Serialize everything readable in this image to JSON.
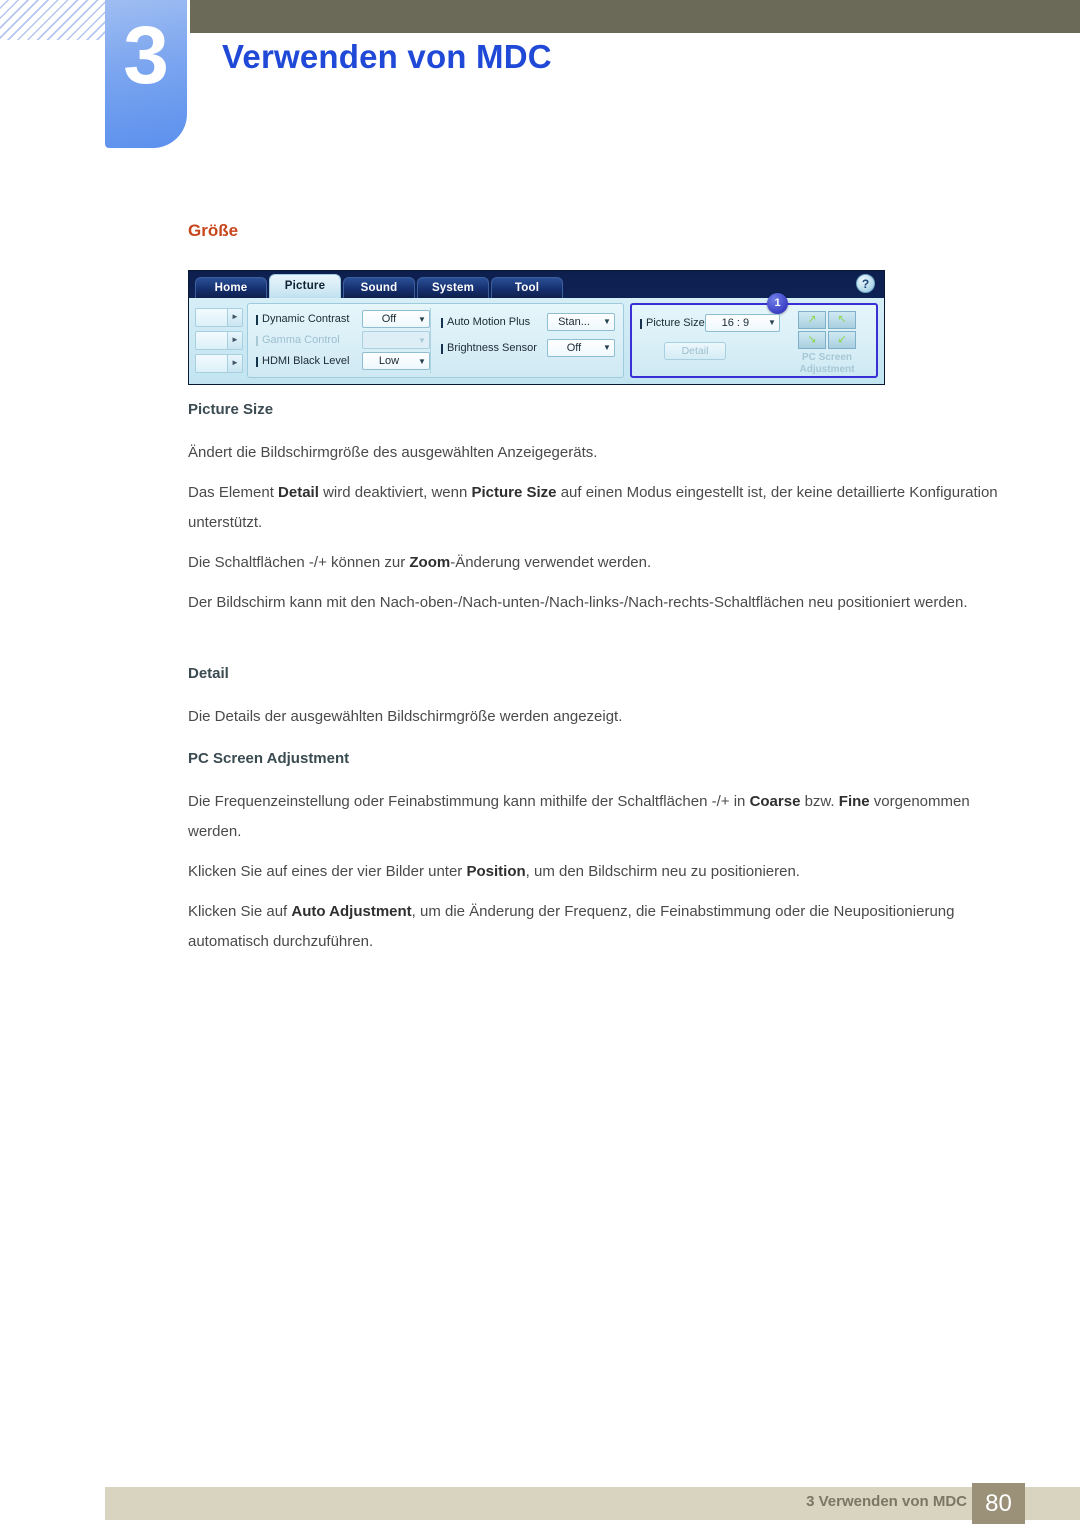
{
  "header": {
    "chapter_number": "3",
    "chapter_title": "Verwenden von MDC"
  },
  "section": {
    "heading": "Größe"
  },
  "mdc_app": {
    "tabs": [
      {
        "label": "Home",
        "active": false
      },
      {
        "label": "Picture",
        "active": true
      },
      {
        "label": "Sound",
        "active": false
      },
      {
        "label": "System",
        "active": false
      },
      {
        "label": "Tool",
        "active": false
      }
    ],
    "help_icon": "?",
    "left_column": [
      {
        "label": "Dynamic Contrast",
        "value": "Off",
        "disabled": false
      },
      {
        "label": "Gamma Control",
        "value": "",
        "disabled": true
      },
      {
        "label": "HDMI Black Level",
        "value": "Low",
        "disabled": false
      }
    ],
    "middle_column": [
      {
        "label": "Auto Motion Plus",
        "value": "Stan...",
        "disabled": false
      },
      {
        "label": "Brightness Sensor",
        "value": "Off",
        "disabled": false
      }
    ],
    "right_panel": {
      "callout_badge": "1",
      "picture_size_label": "Picture Size",
      "picture_size_value": "16 : 9",
      "detail_button": "Detail",
      "pc_screen_adjustment_label": "PC Screen Adjustment",
      "arrow_glyphs": [
        "↗",
        "↖",
        "↘",
        "↙"
      ],
      "highlight_color": "#3a2fd6"
    }
  },
  "body": {
    "h_picture_size": "Picture Size",
    "p1": "Ändert die Bildschirmgröße des ausgewählten Anzeigegeräts.",
    "p2_a": "Das Element ",
    "p2_b1": "Detail",
    "p2_c": " wird deaktiviert, wenn ",
    "p2_b2": "Picture Size",
    "p2_d": " auf einen Modus eingestellt ist, der keine detaillierte Konfiguration unterstützt.",
    "p3_a": "Die Schaltflächen -/+ können zur ",
    "p3_b": "Zoom",
    "p3_c": "-Änderung verwendet werden.",
    "p4": "Der Bildschirm kann mit den Nach-oben-/Nach-unten-/Nach-links-/Nach-rechts-Schaltflächen neu positioniert werden.",
    "h_detail": "Detail",
    "p5": "Die Details der ausgewählten Bildschirmgröße werden angezeigt.",
    "h_pcsa": "PC Screen Adjustment",
    "p6_a": "Die Frequenzeinstellung oder Feinabstimmung kann mithilfe der Schaltflächen -/+ in ",
    "p6_b1": "Coarse",
    "p6_c": " bzw. ",
    "p6_b2": "Fine",
    "p6_d": " vorgenommen werden.",
    "p7_a": "Klicken Sie auf eines der vier Bilder unter ",
    "p7_b": "Position",
    "p7_c": ", um den Bildschirm neu zu positionieren.",
    "p8_a": "Klicken Sie auf ",
    "p8_b": "Auto Adjustment",
    "p8_c": ", um die Änderung der Frequenz, die Feinabstimmung oder die Neupositionierung automatisch durchzuführen."
  },
  "footer": {
    "text": "3 Verwenden von MDC",
    "page_number": "80"
  },
  "colors": {
    "header_bar": "#6b6a58",
    "chapter_tab": "#5b90ee",
    "title_blue": "#1f49d6",
    "section_orange": "#c8461c",
    "footer_bar": "#d8d4c0",
    "footer_page_box": "#9b9179"
  }
}
